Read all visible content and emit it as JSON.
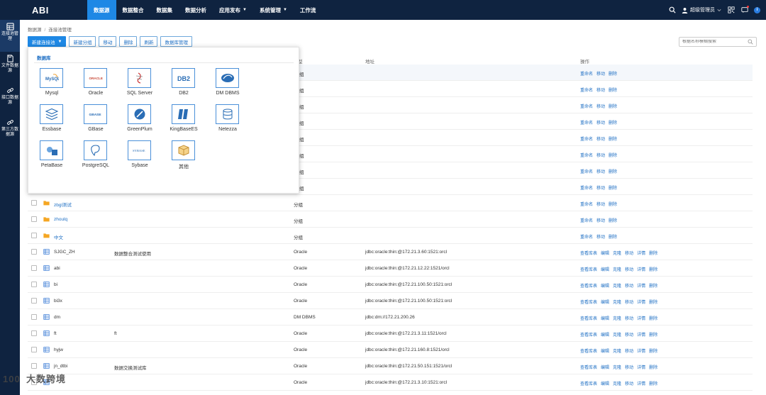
{
  "header": {
    "logo": "ABI",
    "tabs": [
      {
        "label": "数据源",
        "active": true
      },
      {
        "label": "数据整合"
      },
      {
        "label": "数据集"
      },
      {
        "label": "数据分析"
      },
      {
        "label": "应用发布",
        "caret": "▼"
      },
      {
        "label": "系统管理",
        "caret": "▼"
      },
      {
        "label": "工作流"
      }
    ],
    "user": "超级管理员"
  },
  "sidebar": {
    "items": [
      {
        "label": "连接池管理",
        "icon": "database-connection-icon"
      },
      {
        "label": "文件数据源",
        "icon": "file-icon"
      },
      {
        "label": "接口数据源",
        "icon": "link-icon"
      },
      {
        "label": "第三方数据源",
        "icon": "link-icon"
      }
    ]
  },
  "breadcrumb": {
    "root": "数据源",
    "current": "连接池管理"
  },
  "toolbar": {
    "new_pool": "新建连接池",
    "new_group": "新建分组",
    "move": "移动",
    "delete": "删除",
    "refresh": "刷新",
    "db_manage": "数据库管理"
  },
  "search": {
    "placeholder": "根据名称模糊搜索"
  },
  "table": {
    "headers": {
      "type": "型",
      "address": "地址",
      "ops": "操作"
    },
    "folder_ops": [
      "重命名",
      "移动",
      "删除"
    ],
    "db_ops": [
      "查看库表",
      "编辑",
      "克隆",
      "移动",
      "详情",
      "删除"
    ],
    "rows": [
      {
        "kind": "hidden",
        "type": "组"
      },
      {
        "kind": "hidden",
        "type": "组"
      },
      {
        "kind": "hidden",
        "type": "组"
      },
      {
        "kind": "hidden",
        "type": "组"
      },
      {
        "kind": "hidden",
        "type": "组"
      },
      {
        "kind": "hidden",
        "type": "组"
      },
      {
        "kind": "hidden",
        "type": "组"
      },
      {
        "kind": "hidden",
        "type": "组"
      },
      {
        "kind": "folder",
        "name": "zbgl测试",
        "type": "分组"
      },
      {
        "kind": "folder",
        "name": "zhoulq",
        "type": "分组"
      },
      {
        "kind": "folder",
        "name": "中文",
        "type": "分组"
      },
      {
        "kind": "db",
        "name": "SJGC_ZH",
        "desc": "数据整合测试使用",
        "type": "Oracle",
        "address": "jdbc:oracle:thin:@172.21.3.60:1521:orcl"
      },
      {
        "kind": "db",
        "name": "abi",
        "desc": "",
        "type": "Oracle",
        "address": "jdbc:oracle:thin:@172.21.12.22:1521/orcl"
      },
      {
        "kind": "db",
        "name": "bi",
        "desc": "",
        "type": "Oracle",
        "address": "jdbc:oracle:thin:@172.21.100.50:1521:orcl"
      },
      {
        "kind": "db",
        "name": "bi3x",
        "desc": "",
        "type": "Oracle",
        "address": "jdbc:oracle:thin:@172.21.100.50:1521:orcl"
      },
      {
        "kind": "db",
        "name": "dm",
        "desc": "",
        "type": "DM DBMS",
        "address": "jdbc:dm://172.21.200.26"
      },
      {
        "kind": "db",
        "name": "ft",
        "desc": "ft",
        "type": "Oracle",
        "address": "jdbc:oracle:thin:@172.21.3.11:1521/orcl"
      },
      {
        "kind": "db",
        "name": "hyjw",
        "desc": "",
        "type": "Oracle",
        "address": "jdbc:oracle:thin:@172.21.160.8:1521/orcl"
      },
      {
        "kind": "db",
        "name": "jn_dtbi",
        "desc": "数据交换测试库",
        "type": "Oracle",
        "address": "jdbc:oracle:thin:@172.21.50.151:1521/orcl"
      },
      {
        "kind": "db",
        "name": "",
        "desc": "",
        "type": "Oracle",
        "address": "jdbc:oracle:thin:@172.21.3.10:1521:orcl"
      }
    ]
  },
  "dropdown": {
    "title": "数据库",
    "tiles": [
      {
        "label": "Mysql",
        "logo": "MySQL"
      },
      {
        "label": "Oracle",
        "logo": "ORACLE"
      },
      {
        "label": "SQL Server",
        "logo": ""
      },
      {
        "label": "DB2",
        "logo": "DB2"
      },
      {
        "label": "DM DBMS",
        "logo": ""
      },
      {
        "label": "Essbase",
        "logo": ""
      },
      {
        "label": "GBase",
        "logo": "GBASE"
      },
      {
        "label": "GreenPlum",
        "logo": ""
      },
      {
        "label": "KingBaseES",
        "logo": ""
      },
      {
        "label": "Netezza",
        "logo": ""
      },
      {
        "label": "PetaBase",
        "logo": ""
      },
      {
        "label": "PostgreSQL",
        "logo": ""
      },
      {
        "label": "Sybase",
        "logo": "SYBASE"
      },
      {
        "label": "其他",
        "logo": ""
      }
    ]
  },
  "watermark": "大数跨境",
  "colors": {
    "nav": "#0f2340",
    "accent": "#1e88e5",
    "link": "#1e6fc4",
    "folder": "#f5a623"
  }
}
